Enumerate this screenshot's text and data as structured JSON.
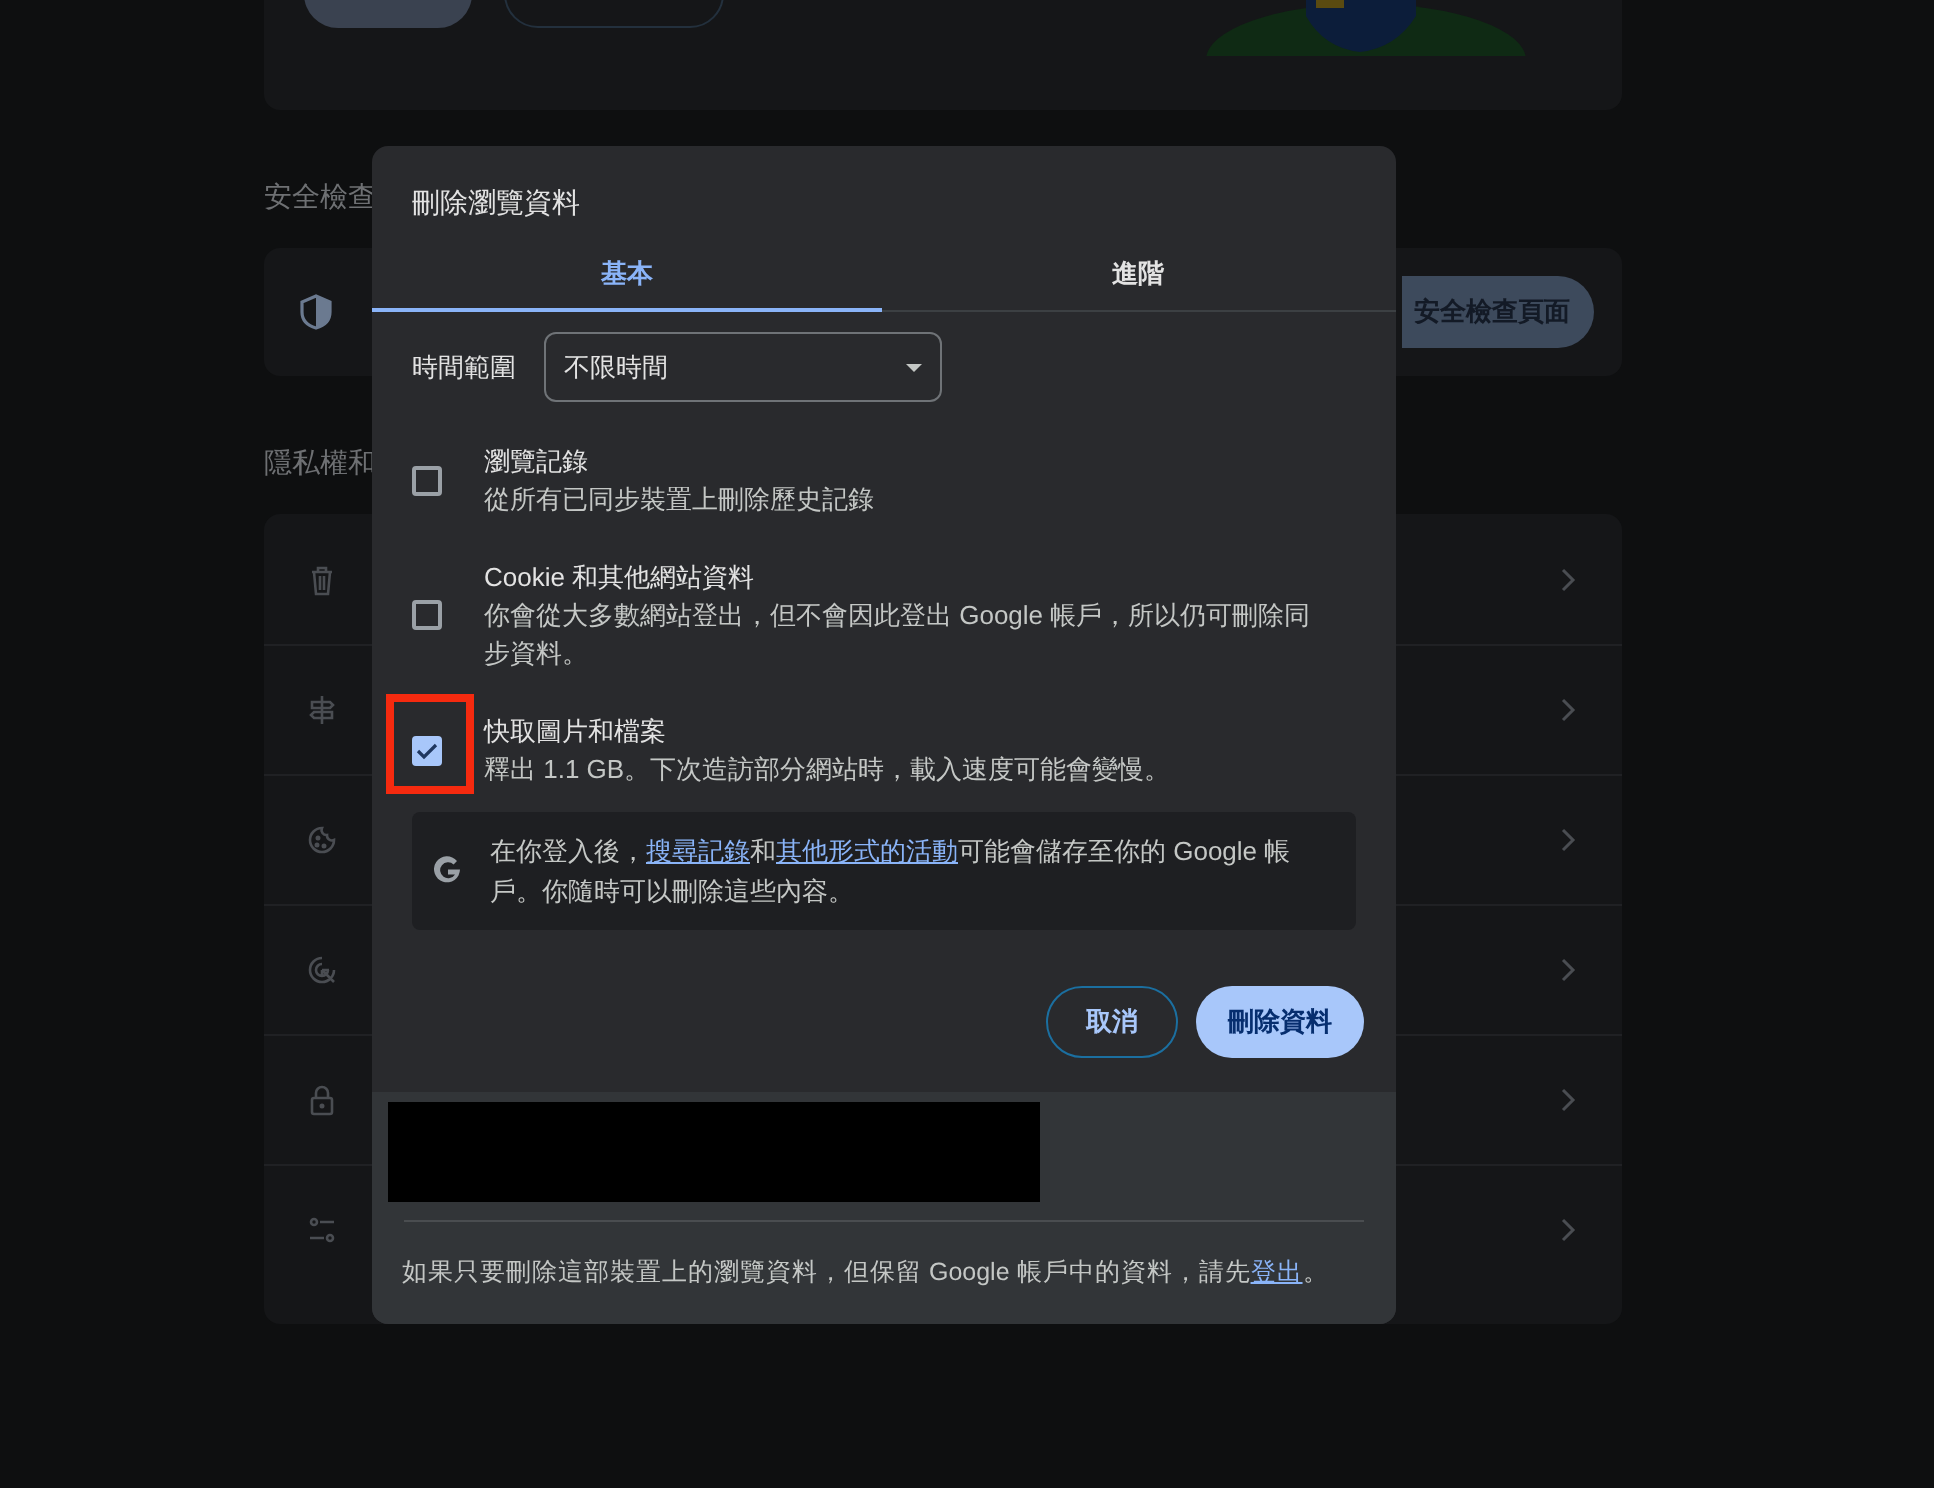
{
  "page": {
    "safety_title": "安全檢查",
    "safety_button": "安全檢查頁面",
    "privacy_title": "隱私權和"
  },
  "dialog": {
    "title": "刪除瀏覽資料",
    "tabs": [
      {
        "label": "基本",
        "selected": true
      },
      {
        "label": "進階",
        "selected": false
      }
    ],
    "time_range": {
      "label": "時間範圍",
      "value": "不限時間"
    },
    "options": [
      {
        "title": "瀏覽記錄",
        "description": "從所有已同步裝置上刪除歷史記錄",
        "checked": false,
        "highlighted": false
      },
      {
        "title": "Cookie 和其他網站資料",
        "description": "你會從大多數網站登出，但不會因此登出 Google 帳戶，所以仍可刪除同步資料。",
        "checked": false,
        "highlighted": false
      },
      {
        "title": "快取圖片和檔案",
        "description": "釋出 1.1 GB。下次造訪部分網站時，載入速度可能會變慢。",
        "checked": true,
        "highlighted": true
      }
    ],
    "notice": [
      {
        "kind": "text",
        "text": "在你登入後，"
      },
      {
        "kind": "link",
        "text": "搜尋記錄"
      },
      {
        "kind": "text",
        "text": "和"
      },
      {
        "kind": "link",
        "text": "其他形式的活動"
      },
      {
        "kind": "text",
        "text": "可能會儲存至你的 Google 帳戶。你隨時可以刪除這些內容。"
      }
    ],
    "buttons": [
      {
        "label": "取消",
        "kind": "outlined"
      },
      {
        "label": "刪除資料",
        "kind": "filled"
      }
    ],
    "footer": [
      {
        "kind": "text",
        "text": "如果只要刪除這部裝置上的瀏覽資料，但保留 Google 帳戶中的資料，請先"
      },
      {
        "kind": "link",
        "text": "登出"
      },
      {
        "kind": "text",
        "text": "。"
      }
    ]
  }
}
